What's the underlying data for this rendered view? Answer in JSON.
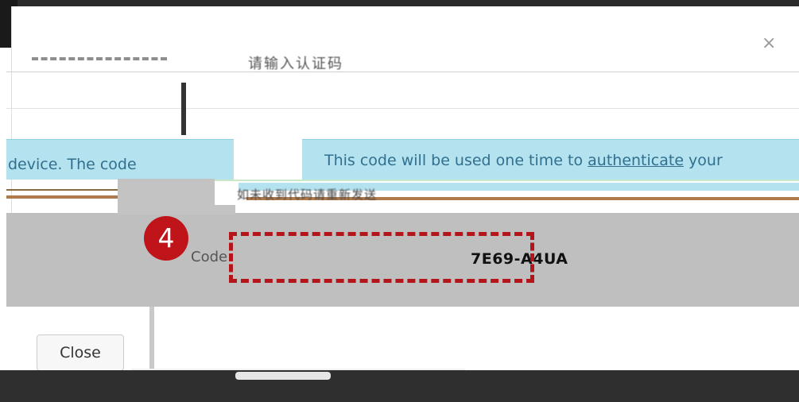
{
  "header": {
    "subtitle": "请输入认证码",
    "close_label": "×"
  },
  "info": {
    "left_text": "device. The code",
    "right_text_pre": "This code will be used one time to ",
    "right_text_link": "authenticate",
    "right_text_post": " your",
    "garbled_line": "如未收到代码请重新发送"
  },
  "code_panel": {
    "step_number": "4",
    "label": "Code",
    "value": "7E69-A4UA"
  },
  "footer": {
    "close_button_label": "Close"
  },
  "colors": {
    "info_bg": "#b4e2ef",
    "info_text": "#31708f",
    "step_badge": "#c0141b",
    "highlight_dash": "#b3151b"
  }
}
